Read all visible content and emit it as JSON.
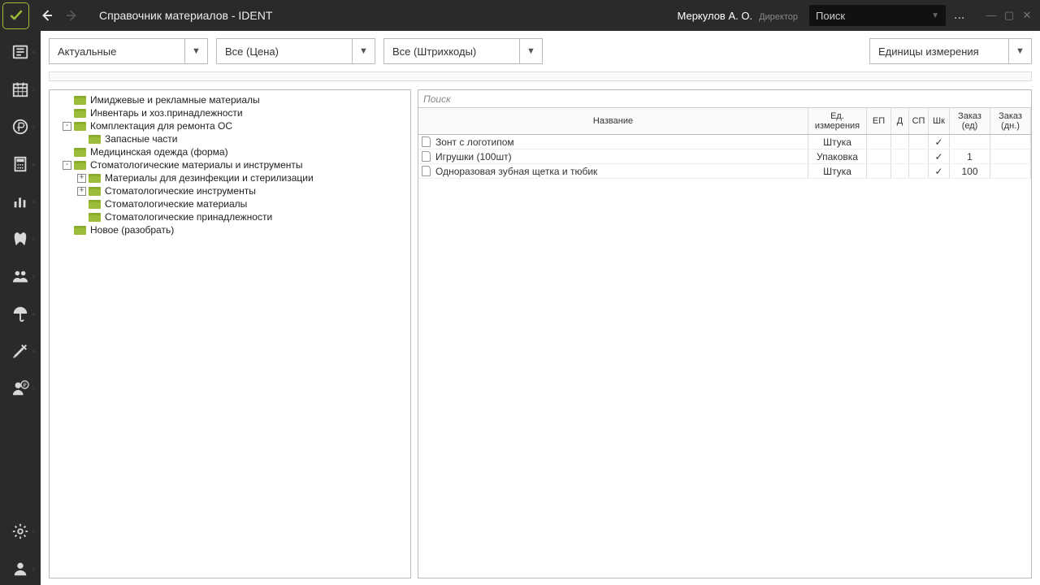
{
  "titlebar": {
    "app_title": "Справочник материалов - IDENT",
    "user_name": "Меркулов А. О.",
    "user_role": "Директор",
    "search_placeholder": "Поиск",
    "menu_dots": "..."
  },
  "toolbar": {
    "filter1": "Актуальные",
    "filter2": "Все (Цена)",
    "filter3": "Все (Штрихкоды)",
    "units": "Единицы измерения"
  },
  "tree": [
    {
      "indent": 0,
      "toggle": "",
      "label": "Имиджевые и рекламные материалы"
    },
    {
      "indent": 0,
      "toggle": "",
      "label": "Инвентарь и хоз.принадлежности"
    },
    {
      "indent": 0,
      "toggle": "-",
      "label": "Комплектация для ремонта ОС"
    },
    {
      "indent": 1,
      "toggle": "",
      "label": "Запасные части"
    },
    {
      "indent": 0,
      "toggle": "",
      "label": "Медицинская одежда (форма)"
    },
    {
      "indent": 0,
      "toggle": "-",
      "label": "Стоматологические материалы и инструменты"
    },
    {
      "indent": 1,
      "toggle": "+",
      "label": "Материалы для дезинфекции и стерилизации"
    },
    {
      "indent": 1,
      "toggle": "+",
      "label": "Стоматологические инструменты"
    },
    {
      "indent": 1,
      "toggle": "",
      "label": "Стоматологические материалы"
    },
    {
      "indent": 1,
      "toggle": "",
      "label": "Стоматологические принадлежности"
    },
    {
      "indent": 0,
      "toggle": "",
      "label": "Новое (разобрать)"
    }
  ],
  "right": {
    "search_label": "Поиск",
    "headers": {
      "name": "Название",
      "unit": "Ед. измерения",
      "ep": "ЕП",
      "d": "Д",
      "sp": "СП",
      "shk": "Шк",
      "order_units": "Заказ (ед)",
      "order_days": "Заказ (дн.)"
    },
    "rows": [
      {
        "name": "Зонт с логотипом",
        "unit": "Штука",
        "ep": "",
        "d": "",
        "sp": "",
        "shk": "✓",
        "ord": "",
        "ord2": ""
      },
      {
        "name": "Игрушки (100шт)",
        "unit": "Упаковка",
        "ep": "",
        "d": "",
        "sp": "",
        "shk": "✓",
        "ord": "1",
        "ord2": ""
      },
      {
        "name": "Одноразовая зубная щетка и тюбик",
        "unit": "Штука",
        "ep": "",
        "d": "",
        "sp": "",
        "shk": "✓",
        "ord": "100",
        "ord2": ""
      }
    ]
  }
}
